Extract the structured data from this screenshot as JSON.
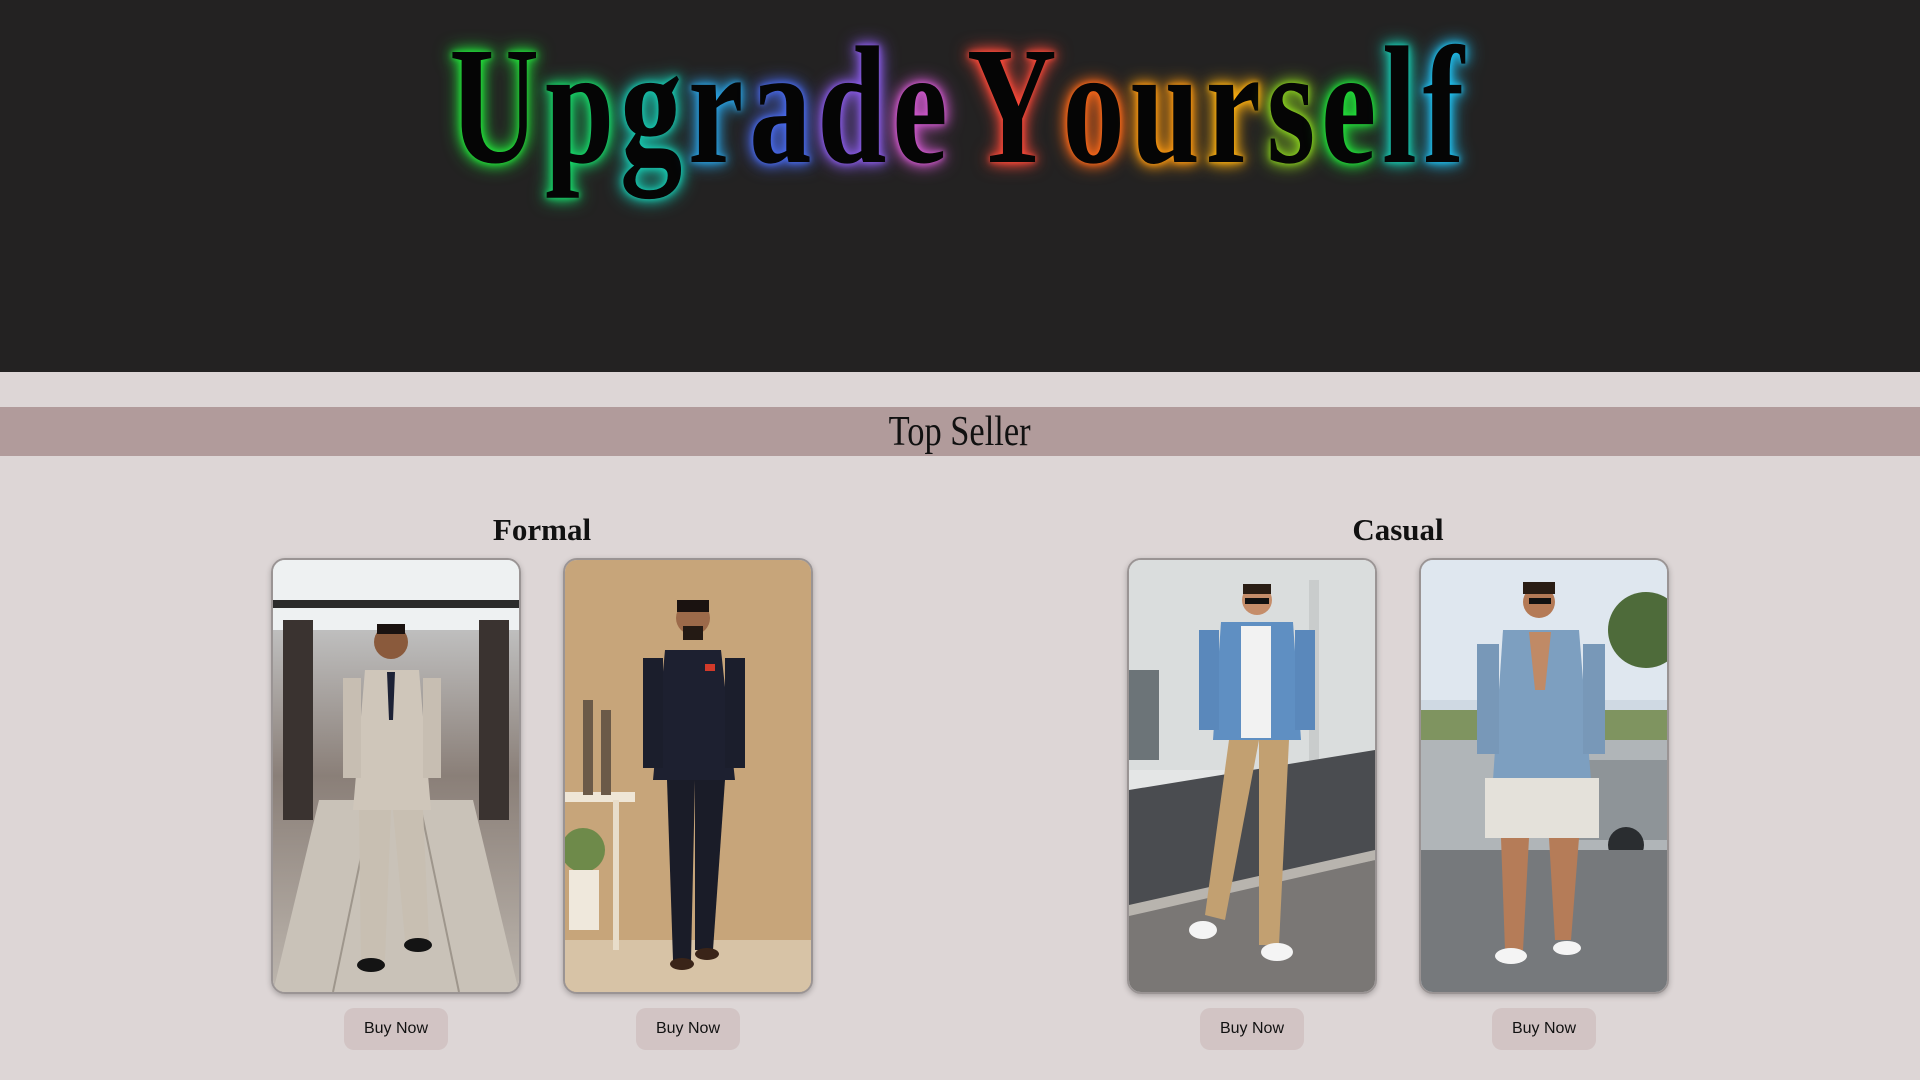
{
  "hero": {
    "letters": [
      {
        "ch": "U",
        "glow": "#22e23a"
      },
      {
        "ch": "p",
        "glow": "#17d86a"
      },
      {
        "ch": "g",
        "glow": "#18c8b0"
      },
      {
        "ch": "r",
        "glow": "#2aa0e0"
      },
      {
        "ch": "a",
        "glow": "#4a6cf0"
      },
      {
        "ch": "d",
        "glow": "#8a5ce8"
      },
      {
        "ch": "e",
        "glow": "#d25ad0"
      },
      {
        "ch": " ",
        "glow": ""
      },
      {
        "ch": "Y",
        "glow": "#ff4a3a"
      },
      {
        "ch": "o",
        "glow": "#ff6a1a"
      },
      {
        "ch": "u",
        "glow": "#ff9a10"
      },
      {
        "ch": "r",
        "glow": "#ffb010"
      },
      {
        "ch": "s",
        "glow": "#8ad020"
      },
      {
        "ch": "e",
        "glow": "#22e23a"
      },
      {
        "ch": "l",
        "glow": "#18c8b0"
      },
      {
        "ch": "f",
        "glow": "#20c0f0"
      }
    ]
  },
  "section": {
    "title": "Top Seller"
  },
  "categories": [
    {
      "title": "Formal",
      "products": [
        {
          "image": "man-in-beige-three-piece-suit",
          "button": "Buy Now"
        },
        {
          "image": "man-in-black-bandhgala-suit",
          "button": "Buy Now"
        }
      ]
    },
    {
      "title": "Casual",
      "products": [
        {
          "image": "man-in-denim-jacket-and-khaki-pants",
          "button": "Buy Now"
        },
        {
          "image": "man-in-denim-shirt-and-shorts",
          "button": "Buy Now"
        }
      ]
    }
  ],
  "colors": {
    "hero_bg": "#232222",
    "page_bg": "#ddd6d6",
    "band_bg": "#b19b9b",
    "button_bg": "#d2c4c4"
  }
}
